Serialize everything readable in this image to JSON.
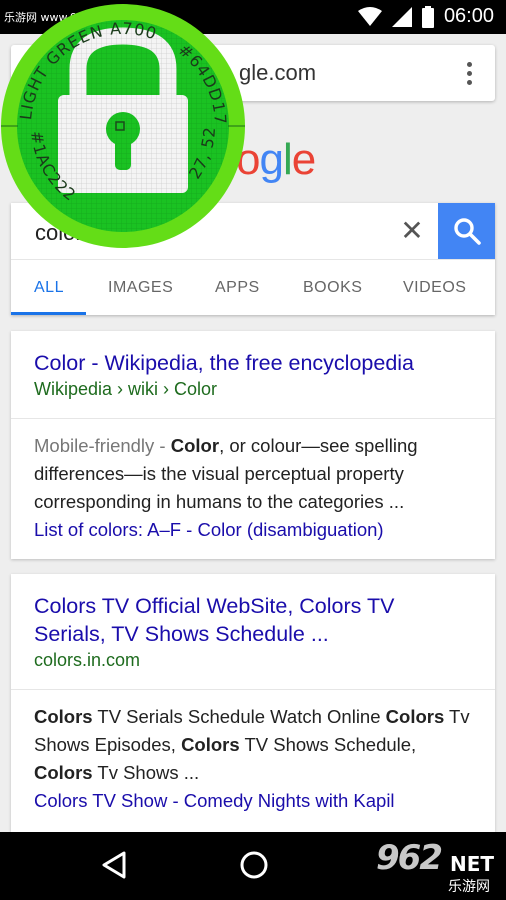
{
  "status_bar": {
    "watermark": "乐游网 www.962.net",
    "time": "06:00"
  },
  "url_bar": {
    "url": "gle.com",
    "menu_icon": "more-vert-icon"
  },
  "logo": {
    "letters": [
      "o",
      "g",
      "l",
      "e"
    ],
    "colors": [
      "#ea4335",
      "#4285f4",
      "#34a853",
      "#ea4335"
    ]
  },
  "search": {
    "value": "colors",
    "clear_icon": "close-icon",
    "search_icon": "search-icon",
    "accent": "#4285f4"
  },
  "tabs": [
    {
      "label": "ALL",
      "active": true
    },
    {
      "label": "IMAGES",
      "active": false
    },
    {
      "label": "APPS",
      "active": false
    },
    {
      "label": "BOOKS",
      "active": false
    },
    {
      "label": "VIDEOS",
      "active": false
    }
  ],
  "results": [
    {
      "title": "Color - Wikipedia, the free encyclopedia",
      "url": "Wikipedia › wiki › Color",
      "snippet_muted": "Mobile-friendly - ",
      "snippet_bold": "Color",
      "snippet_rest": ", or colour—see spelling differences—is the visual perceptual property corresponding in humans to the categories ...",
      "links": "List of colors: A–F - Color (disambiguation)"
    },
    {
      "title": "Colors TV Official WebSite, Colors TV Serials, TV Shows Schedule ...",
      "url": "colors.in.com",
      "snippet_parts": [
        {
          "text": "Colors",
          "bold": true
        },
        {
          "text": " TV Serials Schedule Watch Online ",
          "bold": false
        },
        {
          "text": "Colors",
          "bold": true
        },
        {
          "text": " Tv Shows Episodes, ",
          "bold": false
        },
        {
          "text": "Colors",
          "bold": true
        },
        {
          "text": " TV Shows Schedule, ",
          "bold": false
        },
        {
          "text": "Colors",
          "bold": true
        },
        {
          "text": " Tv Shows ...",
          "bold": false
        }
      ],
      "links": "Colors TV Show - Comedy Nights with Kapil"
    }
  ],
  "overlay": {
    "top_text": "LIGHT GREEN A700",
    "hex_top": "#64DD17",
    "hex_bottom": "#1AC222",
    "value_text": "27, 52",
    "ring_color": "#64dd17",
    "fill_color": "#1ac222"
  },
  "nav_bar": {
    "back_icon": "back-triangle-icon",
    "home_icon": "home-circle-icon",
    "brand_number": "962",
    "brand_suffix": "NET",
    "brand_chinese": "乐游网"
  },
  "colors": {
    "link": "#1a0dab",
    "url_green": "#1e6b1e"
  }
}
